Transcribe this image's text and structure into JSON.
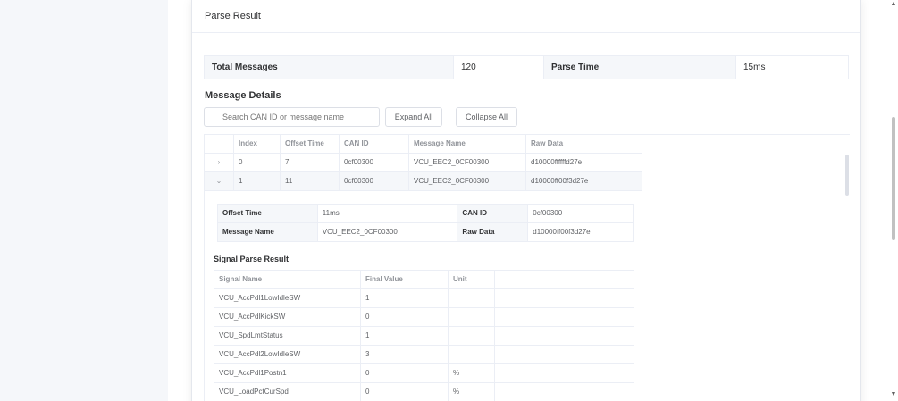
{
  "card": {
    "title": "Parse Result"
  },
  "summary": {
    "total_label": "Total Messages",
    "total_value": "120",
    "time_label": "Parse Time",
    "time_value": "15ms"
  },
  "details": {
    "title": "Message Details",
    "search_placeholder": "Search CAN ID or message name",
    "expand_all": "Expand All",
    "collapse_all": "Collapse All"
  },
  "table": {
    "headers": [
      "Index",
      "Offset Time",
      "CAN ID",
      "Message Name",
      "Raw Data"
    ],
    "rows": [
      {
        "expand_glyph": "›",
        "index": "0",
        "offset": "7",
        "can_id": "0cf00300",
        "name": "VCU_EEC2_0CF00300",
        "raw": "d10000ffffffd27e"
      },
      {
        "expand_glyph": "⌄",
        "index": "1",
        "offset": "11",
        "can_id": "0cf00300",
        "name": "VCU_EEC2_0CF00300",
        "raw": "d10000ff00f3d27e"
      }
    ]
  },
  "expanded": {
    "offset_label": "Offset Time",
    "offset_value": "11ms",
    "canid_label": "CAN ID",
    "canid_value": "0cf00300",
    "name_label": "Message Name",
    "name_value": "VCU_EEC2_0CF00300",
    "raw_label": "Raw Data",
    "raw_value": "d10000ff00f3d27e",
    "signal_title": "Signal Parse Result",
    "signal_headers": [
      "Signal Name",
      "Final Value",
      "Unit"
    ],
    "signals": [
      {
        "name": "VCU_AccPdl1LowIdleSW",
        "value": "1",
        "unit": ""
      },
      {
        "name": "VCU_AccPdlKickSW",
        "value": "0",
        "unit": ""
      },
      {
        "name": "VCU_SpdLmtStatus",
        "value": "1",
        "unit": ""
      },
      {
        "name": "VCU_AccPdl2LowIdleSW",
        "value": "3",
        "unit": ""
      },
      {
        "name": "VCU_AccPdl1Postn1",
        "value": "0",
        "unit": "%"
      },
      {
        "name": "VCU_LoadPctCurSpd",
        "value": "0",
        "unit": "%"
      }
    ]
  },
  "scrollbar": {
    "up_icon": "▲",
    "down_icon": "▼"
  }
}
